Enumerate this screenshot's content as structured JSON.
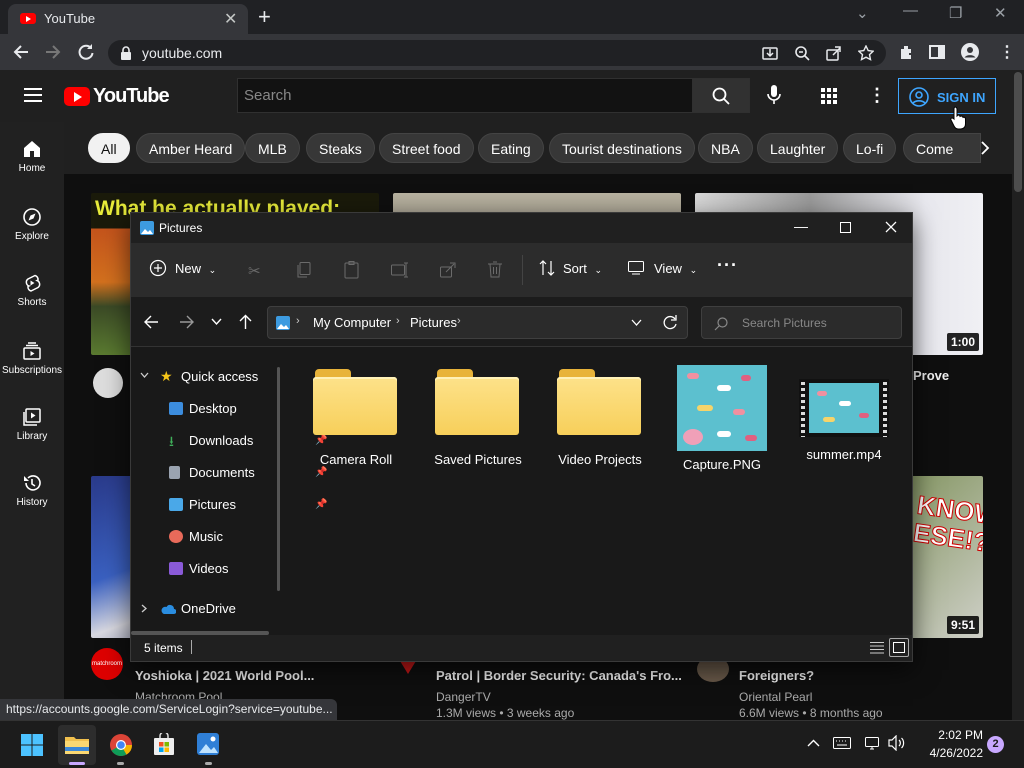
{
  "browser": {
    "tab_title": "YouTube",
    "url": "youtube.com",
    "status_url": "https://accounts.google.com/ServiceLogin?service=youtube..."
  },
  "youtube": {
    "logo_text": "YouTube",
    "search_placeholder": "Search",
    "sign_in": "SIGN IN",
    "sidebar": [
      {
        "label": "Home",
        "icon": "home-icon"
      },
      {
        "label": "Explore",
        "icon": "compass-icon"
      },
      {
        "label": "Shorts",
        "icon": "shorts-icon"
      },
      {
        "label": "Subscriptions",
        "icon": "subscriptions-icon"
      },
      {
        "label": "Library",
        "icon": "library-icon"
      },
      {
        "label": "History",
        "icon": "history-icon"
      }
    ],
    "chips": [
      "All",
      "Amber Heard",
      "MLB",
      "Steaks",
      "Street food",
      "Eating",
      "Tourist destinations",
      "NBA",
      "Laughter",
      "Lo-fi",
      "Come"
    ],
    "thumb_text_1": "What he actually played:",
    "row1": [
      {
        "duration": "1:00",
        "title_fragment": "Prove"
      }
    ],
    "row2": [
      {
        "title": "Yoshioka | 2021 World Pool...",
        "channel": "Matchroom Pool",
        "avatar_text": "matchroom"
      },
      {
        "title": "Patrol | Border Security: Canada's Fro...",
        "channel": "DangerTV",
        "meta": "1.3M views • 3 weeks ago"
      },
      {
        "title": "Foreigners?",
        "channel": "Oriental Pearl",
        "meta": "6.6M views • 8 months ago",
        "duration": "9:51",
        "thumb_text": "KNOW ESE!?"
      }
    ]
  },
  "explorer": {
    "title": "Pictures",
    "toolbar": {
      "new": "New",
      "sort": "Sort",
      "view": "View"
    },
    "breadcrumb": [
      "My Computer",
      "Pictures"
    ],
    "search_placeholder": "Search Pictures",
    "nav": {
      "quick_access": "Quick access",
      "items": [
        {
          "label": "Desktop",
          "color": "#3c8dde",
          "pinned": true
        },
        {
          "label": "Downloads",
          "color": "#3fae5a",
          "pinned": true
        },
        {
          "label": "Documents",
          "color": "#9aa3b0",
          "pinned": true
        },
        {
          "label": "Pictures",
          "color": "#4aa8e8",
          "pinned": true
        },
        {
          "label": "Music",
          "color": "#e86a5a",
          "pinned": false
        },
        {
          "label": "Videos",
          "color": "#8a5ad8",
          "pinned": false
        }
      ],
      "onedrive": "OneDrive"
    },
    "files": [
      {
        "name": "Camera Roll",
        "type": "folder"
      },
      {
        "name": "Saved Pictures",
        "type": "folder"
      },
      {
        "name": "Video Projects",
        "type": "folder"
      },
      {
        "name": "Capture.PNG",
        "type": "image"
      },
      {
        "name": "summer.mp4",
        "type": "video"
      }
    ],
    "status": "5 items"
  },
  "taskbar": {
    "time": "2:02 PM",
    "date": "4/26/2022",
    "notifications": "2"
  }
}
